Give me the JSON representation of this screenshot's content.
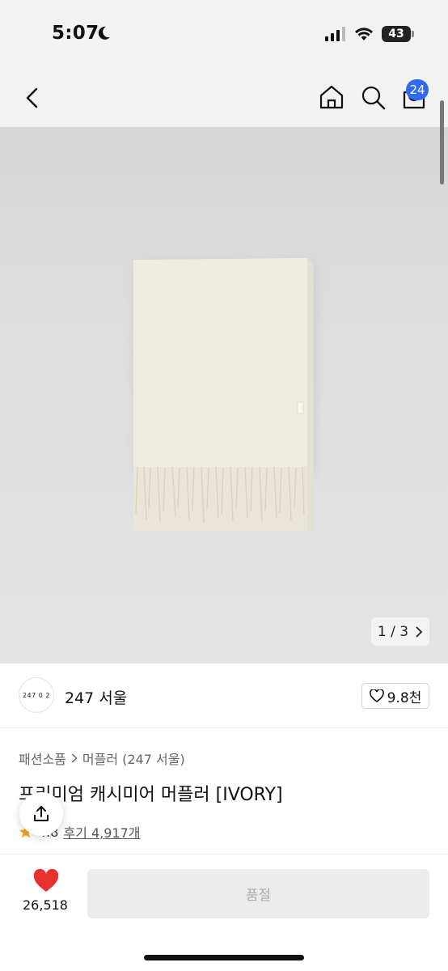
{
  "status": {
    "time": "5:07",
    "battery": "43"
  },
  "header": {
    "cart_count": "24"
  },
  "image": {
    "page_current": "1",
    "page_separator": "/",
    "page_total": "3"
  },
  "brand": {
    "logo_text": "247 0 2",
    "name": "247 서울",
    "likes": "9.8천"
  },
  "product": {
    "breadcrumb_category": "패션소품",
    "breadcrumb_sub": "머플러 (247 서울)",
    "title": "프리미엄 캐시미어 머플러 [IVORY]",
    "rating": "4.8",
    "reviews": "후기 4,917개"
  },
  "bottom": {
    "heart_count": "26,518",
    "soldout_label": "품절"
  },
  "colors": {
    "accent_badge": "#2f6bf0",
    "heart": "#e8312f",
    "star": "#f5a623"
  }
}
